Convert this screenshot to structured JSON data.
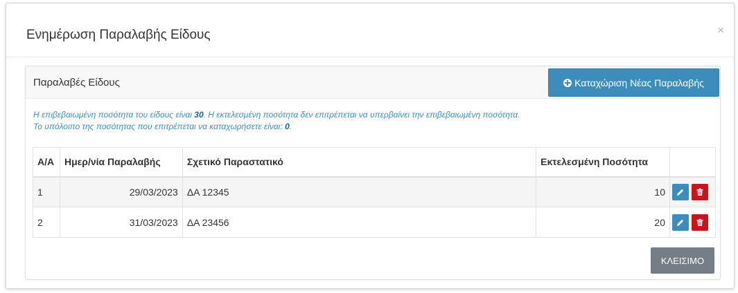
{
  "modal": {
    "title": "Ενημέρωση Παραλαβής Είδους",
    "close_glyph": "×"
  },
  "panel": {
    "title": "Παραλαβές Είδους",
    "add_button_label": "Καταχώριση Νέας Παραλαβής",
    "info": {
      "line1_part1": "Η επιβεβαιωμένη ποσότητα του είδους είναι ",
      "confirmed_qty": "30",
      "line1_part2": ". Η εκτελεσμένη ποσότητα δεν επιτρέπεται να υπερβαίνει την επιβεβαιωμένη ποσότητα.",
      "line2_part1": "Το υπόλοιπο της ποσότητας που επιτρέπεται να καταχωρήσετε είναι: ",
      "remaining_qty": "0",
      "line2_part2": "."
    }
  },
  "table": {
    "headers": [
      "Α/Α",
      "Ημερ/νία Παραλαβής",
      "Σχετικό Παραστατικό",
      "Εκτελεσμένη Ποσότητα"
    ],
    "rows": [
      {
        "aa": "1",
        "date": "29/03/2023",
        "doc": "ΔΑ 12345",
        "qty": "10"
      },
      {
        "aa": "2",
        "date": "31/03/2023",
        "doc": "ΔΑ 23456",
        "qty": "20"
      }
    ]
  },
  "footer": {
    "close_label": "ΚΛΕΙΣΙΜΟ"
  },
  "colors": {
    "primary": "#3c8dbc",
    "danger": "#c9151e",
    "secondary": "#757e86"
  },
  "icons": {
    "add": "plus-circle-icon",
    "edit": "pencil-icon",
    "delete": "trash-icon",
    "close": "close-icon"
  }
}
